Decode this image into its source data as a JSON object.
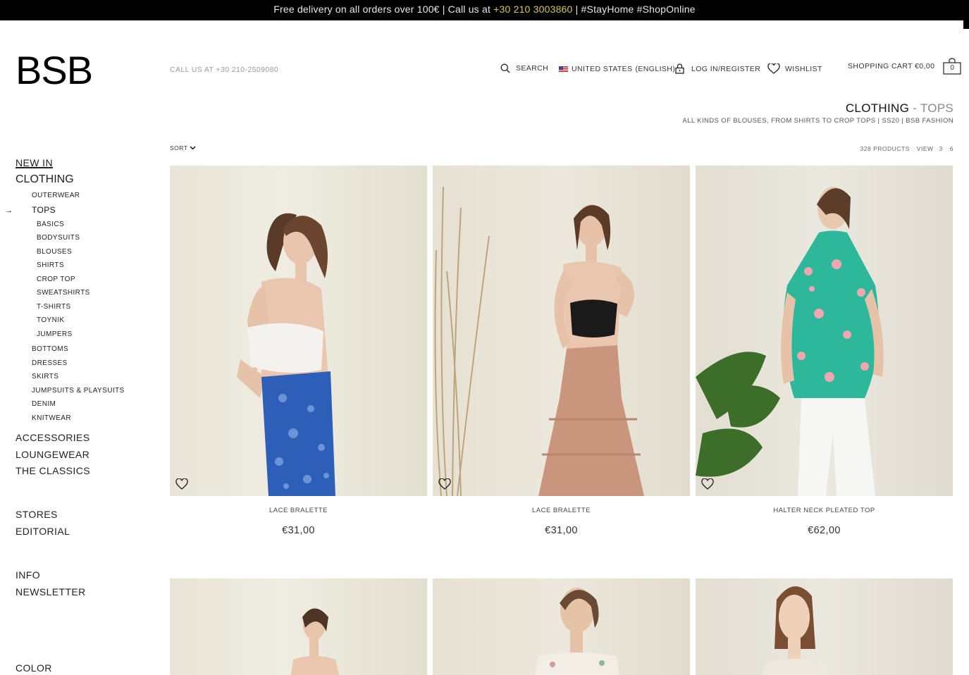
{
  "promo": {
    "text_before": "Free delivery on all orders over 100€ | Call us at ",
    "phone": "+30 210 3003860",
    "text_after": " | #StayHome #ShopOnline"
  },
  "brand": {
    "logo": "BSB"
  },
  "header": {
    "call_us": "CALL US AT +30 210-2509080",
    "search_label": "SEARCH",
    "country_label": "UNITED STATES",
    "language_label": "(ENGLISH)",
    "login_label": "LOG IN/REGISTER",
    "wishlist_label": "WISHLIST",
    "cart_label": "SHOPPING CART €0,00",
    "cart_count": "0"
  },
  "category": {
    "title": "CLOTHING",
    "separator": " - ",
    "subtitle": "TOPS",
    "description": "ALL KINDS OF BLOUSES, FROM SHIRTS TO CROP TOPS | SS20 | BSB FASHION"
  },
  "toolbar": {
    "sort_label": "SORT",
    "product_count": "328 PRODUCTS",
    "view_label": "VIEW",
    "view_options": [
      "3",
      "6"
    ]
  },
  "sidebar": {
    "new_in": "NEW IN",
    "clothing": "CLOTHING",
    "outerwear": "OUTERWEAR",
    "tops": "TOPS",
    "tops_sub": [
      "BASICS",
      "BODYSUITS",
      "BLOUSES",
      "SHIRTS",
      "CROP TOP",
      "SWEATSHIRTS",
      "T-SHIRTS",
      "TOYNIK",
      "JUMPERS"
    ],
    "clothing_rest": [
      "BOTTOMS",
      "DRESSES",
      "SKIRTS",
      "JUMPSUITS & PLAYSUITS",
      "DENIM",
      "KNITWEAR"
    ],
    "main_rest": [
      "ACCESSORIES",
      "LOUNGEWEAR",
      "THE CLASSICS"
    ],
    "secondary": [
      "STORES",
      "EDITORIAL"
    ],
    "tertiary": [
      "INFO",
      "NEWSLETTER"
    ],
    "filter": "COLOR"
  },
  "products": [
    {
      "name": "LACE BRALETTE",
      "price": "€31,00"
    },
    {
      "name": "LACE BRALETTE",
      "price": "€31,00"
    },
    {
      "name": "HALTER NECK PLEATED TOP",
      "price": "€62,00"
    }
  ],
  "colors": {
    "accent": "#c8102e",
    "promo_phone": "#d8c64a",
    "topbar": "#000000"
  }
}
